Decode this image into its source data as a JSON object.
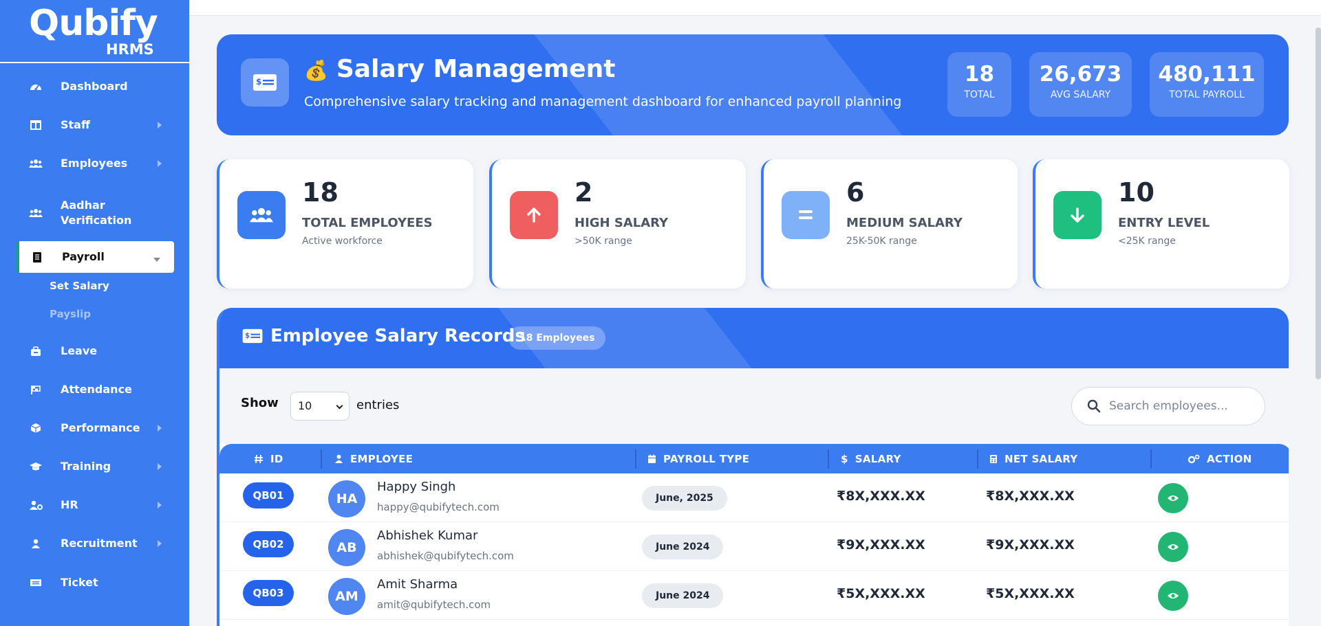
{
  "brand": {
    "name": "Qubify",
    "sub": "HRMS"
  },
  "sidebar": {
    "items": [
      {
        "label": "Dashboard",
        "icon": "gauge-icon",
        "arrow": false
      },
      {
        "label": "Staff",
        "icon": "columns-icon",
        "arrow": true
      },
      {
        "label": "Employees",
        "icon": "users-icon",
        "arrow": true
      },
      {
        "label": "Aadhar",
        "label2": "Verification",
        "icon": "users-icon",
        "arrow": false
      },
      {
        "label": "Payroll",
        "icon": "receipt-icon",
        "active": true
      },
      {
        "label": "Leave",
        "icon": "briefcase-icon",
        "arrow": false
      },
      {
        "label": "Attendance",
        "icon": "flag-icon",
        "arrow": false
      },
      {
        "label": "Performance",
        "icon": "cube-icon",
        "arrow": true
      },
      {
        "label": "Training",
        "icon": "graduation-icon",
        "arrow": true
      },
      {
        "label": "HR",
        "icon": "user-gear-icon",
        "arrow": true
      },
      {
        "label": "Recruitment",
        "icon": "user-icon",
        "arrow": true
      },
      {
        "label": "Ticket",
        "icon": "ticket-icon",
        "arrow": false
      }
    ],
    "sub_items": [
      {
        "label": "Set Salary",
        "active": true
      },
      {
        "label": "Payslip",
        "active": false
      }
    ]
  },
  "hero": {
    "emoji": "💰",
    "title": "Salary Management",
    "description": "Comprehensive salary tracking and management dashboard for enhanced payroll planning",
    "stats": [
      {
        "value": "18",
        "label": "TOTAL"
      },
      {
        "value": "26,673",
        "label": "AVG SALARY"
      },
      {
        "value": "480,111",
        "label": "TOTAL PAYROLL"
      }
    ]
  },
  "cards": [
    {
      "value": "18",
      "label": "TOTAL EMPLOYEES",
      "sub": "Active workforce",
      "icon": "users-icon",
      "color": "#3b7cf1"
    },
    {
      "value": "2",
      "label": "HIGH SALARY",
      "sub": ">50K range",
      "icon": "arrow-up-icon",
      "color": "#ef5f5f"
    },
    {
      "value": "6",
      "label": "MEDIUM SALARY",
      "sub": "25K-50K range",
      "icon": "equals-icon",
      "color": "#7eb1f7"
    },
    {
      "value": "10",
      "label": "ENTRY LEVEL",
      "sub": "<25K range",
      "icon": "arrow-down-icon",
      "color": "#1fbf7f"
    }
  ],
  "records": {
    "title": "Employee Salary Records",
    "badge": "18 Employees",
    "show_label": "Show",
    "entries_value": "10",
    "entries_label": "entries",
    "search_placeholder": "Search employees...",
    "columns": [
      {
        "label": "ID",
        "icon": "hash-icon"
      },
      {
        "label": "EMPLOYEE",
        "icon": "user-icon"
      },
      {
        "label": "PAYROLL TYPE",
        "icon": "calendar-icon"
      },
      {
        "label": "SALARY",
        "icon": "dollar-icon"
      },
      {
        "label": "NET SALARY",
        "icon": "calculator-icon"
      },
      {
        "label": "ACTION",
        "icon": "cogs-icon"
      }
    ],
    "rows": [
      {
        "id": "QB01",
        "initials": "HA",
        "name": "Happy Singh",
        "email": "happy@qubifytech.com",
        "payroll": "June, 2025",
        "salary": "₹8X,XXX.XX",
        "net": "₹8X,XXX.XX"
      },
      {
        "id": "QB02",
        "initials": "AB",
        "name": "Abhishek Kumar",
        "email": "abhishek@qubifytech.com",
        "payroll": "June 2024",
        "salary": "₹9X,XXX.XX",
        "net": "₹9X,XXX.XX"
      },
      {
        "id": "QB03",
        "initials": "AM",
        "name": "Amit Sharma",
        "email": "amit@qubifytech.com",
        "payroll": "June 2024",
        "salary": "₹5X,XXX.XX",
        "net": "₹5X,XXX.XX"
      }
    ]
  }
}
